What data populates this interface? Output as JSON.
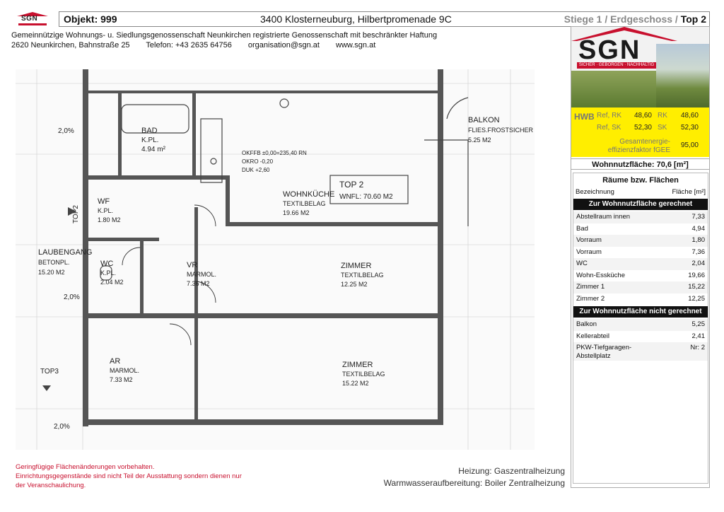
{
  "logo": {
    "text": "SGN"
  },
  "header": {
    "objekt": "Objekt:  999",
    "address": "3400 Klosterneuburg, Hilbertpromenade 9C",
    "stiege_prefix": "Stiege 1 / Erdgeschoss / ",
    "top": "Top 2"
  },
  "company": {
    "name": "Gemeinnützige Wohnungs- u. Siedlungsgenossenschaft Neunkirchen registrierte Genossenschaft mit beschränkter Haftung",
    "address": "2620 Neunkirchen, Bahnstraße 25",
    "phone": "Telefon: +43 2635 64756",
    "email": "organisation@sgn.at",
    "web": "www.sgn.at"
  },
  "brand": {
    "name": "SGN",
    "tagline": "SICHER · GEBORGEN · NACHHALTIG"
  },
  "energy": {
    "hwb_label": "HWB",
    "ref_rk_label": "Ref, RK",
    "ref_rk": "48,60",
    "rk_label": "RK",
    "rk": "48,60",
    "ref_sk_label": "Ref, SK",
    "ref_sk": "52,30",
    "sk_label": "SK",
    "sk": "52,30",
    "fgee_label": "Gesamtenergie-effizienzfaktor fGEE",
    "fgee": "95,00"
  },
  "wohnnutzflaeche": "Wohnnutzfläche: 70,6 [m²]",
  "rooms": {
    "title": "Räume bzw. Flächen",
    "col_name": "Bezeichnung",
    "col_area": "Fläche [m²]",
    "group1": "Zur Wohnnutzfläche gerechnet",
    "items1": [
      {
        "name": "Abstellraum innen",
        "area": "7,33"
      },
      {
        "name": "Bad",
        "area": "4,94"
      },
      {
        "name": "Vorraum",
        "area": "1,80"
      },
      {
        "name": "Vorraum",
        "area": "7,36"
      },
      {
        "name": "WC",
        "area": "2,04"
      },
      {
        "name": "Wohn-Essküche",
        "area": "19,66"
      },
      {
        "name": "Zimmer 1",
        "area": "15,22"
      },
      {
        "name": "Zimmer 2",
        "area": "12,25"
      }
    ],
    "group2": "Zur Wohnnutzfläche nicht gerechnet",
    "items2": [
      {
        "name": "Balkon",
        "area": "5,25"
      },
      {
        "name": "Kellerabteil",
        "area": "2,41"
      },
      {
        "name": "PKW-Tiefgaragen-Abstellplatz",
        "area": "Nr: 2"
      }
    ]
  },
  "notes": {
    "line1": "Geringfügige Flächenänderungen vorbehalten.",
    "line2": "Einrichtungsgegenstände sind nicht Teil der Ausstattung sondern dienen nur der Veranschaulichung."
  },
  "heating": {
    "heizung": "Heizung: Gaszentralheizung",
    "warmwasser": "Warmwasseraufbereitung: Boiler Zentralheizung"
  },
  "plan": {
    "bad": "BAD",
    "bad_floor": "K.PL.",
    "bad_area": "4.94 m²",
    "balkon": "BALKON",
    "balkon_floor": "FLIES.FROSTSICHER",
    "balkon_area": "5.25 M2",
    "kueche": "WOHNKÜCHE",
    "kueche_floor": "TEXTILBELAG",
    "kueche_area": "19.66 M2",
    "top_box": "TOP 2",
    "top_wnfl": "WNFL:    70.60 M2",
    "wf": "WF",
    "wf_floor": "K.PL.",
    "wf_area": "1.80 M2",
    "laubengang": "LAUBENGANG",
    "laubengang_floor": "BETONPL.",
    "laubengang_area": "15.20 M2",
    "wc": "WC",
    "wc_floor": "K.PL.",
    "wc_area": "2.04 M2",
    "vr": "VR",
    "vr_floor": "MARMOL.",
    "vr_area": "7.36 M2",
    "zimmer1": "ZIMMER",
    "zimmer1_floor": "TEXTILBELAG",
    "zimmer1_area": "12.25 M2",
    "ar": "AR",
    "ar_floor": "MARMOL.",
    "ar_area": "7.33 M2",
    "zimmer2": "ZIMMER",
    "zimmer2_floor": "TEXTILBELAG",
    "zimmer2_area": "15.22 M2",
    "okffb": "OKFFB   ±0,00=235,40 RN",
    "okro": "OKRO      -0,20",
    "duk": "DUK        +2,60",
    "top2_mark": "TOP2",
    "top3_mark": "TOP3",
    "pct1": "2,0%",
    "pct2": "2,0%",
    "pct3": "2,0%"
  }
}
